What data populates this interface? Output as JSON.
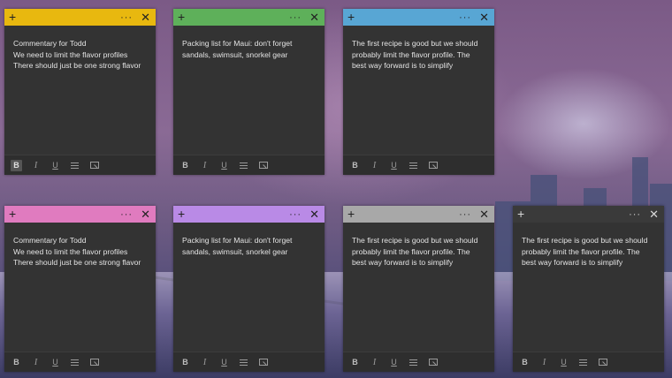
{
  "notes": [
    {
      "color": "#e8b80f",
      "dark": false,
      "lines": [
        "Commentary for Todd",
        "We need to limit the flavor profiles",
        "There should just be one strong flavor"
      ]
    },
    {
      "color": "#5eb05a",
      "dark": false,
      "lines": [
        "Packing list for Maui: don't forget",
        "sandals, swimsuit, snorkel gear"
      ]
    },
    {
      "color": "#58a6d4",
      "dark": false,
      "lines": [
        "The first recipe is good but we should",
        "probably limit the flavor profile. The",
        "best way forward is to simplify"
      ]
    },
    {
      "color": "#e07bbf",
      "dark": false,
      "lines": [
        "Commentary for Todd",
        "We need to limit the flavor profiles",
        "There should just be one strong flavor"
      ]
    },
    {
      "color": "#b98ae6",
      "dark": false,
      "lines": [
        "Packing list for Maui: don't forget",
        "sandals, swimsuit, snorkel gear"
      ]
    },
    {
      "color": "#a8a8a8",
      "dark": false,
      "lines": [
        "The first recipe is good but we should",
        "probably limit the flavor profile. The",
        "best way forward is to simplify"
      ]
    },
    {
      "color": "#3a3a3a",
      "dark": true,
      "lines": [
        "The first recipe is good but we should",
        "probably limit the flavor profile. The",
        "best way forward is to simplify"
      ]
    }
  ],
  "header": {
    "add_glyph": "+",
    "menu_glyph": "···",
    "close_glyph": "✕"
  },
  "toolbar": {
    "bold": "B",
    "italic": "I",
    "underline": "U"
  }
}
